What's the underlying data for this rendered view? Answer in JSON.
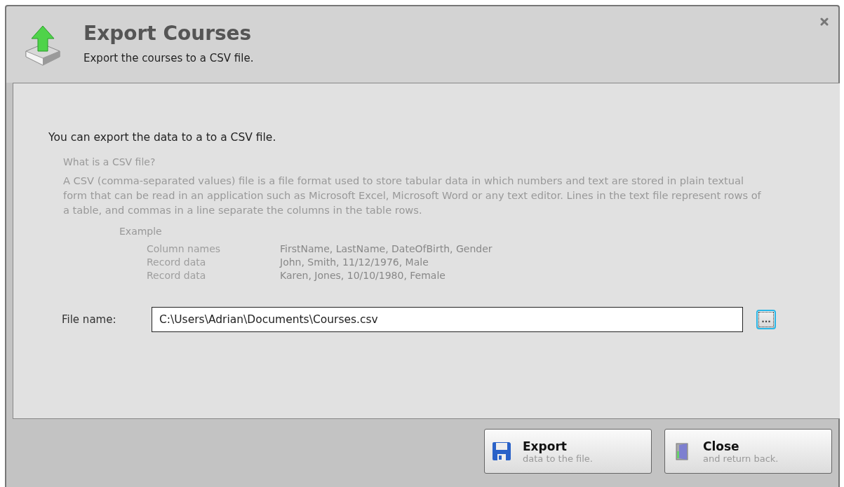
{
  "dialog": {
    "title": "Export Courses",
    "subtitle": "Export the courses to a CSV file."
  },
  "intro": "You can export the data to a to a CSV file.",
  "help": {
    "heading": "What is a CSV file?",
    "body": "A CSV (comma-separated values) file is a file format used to store tabular data in which numbers and text are stored in plain textual form that can be read in an application such as Microsoft Excel, Microsoft Word or any text editor. Lines in the text file represent rows of a table, and commas in a line separate the columns in the table rows.",
    "example_heading": "Example",
    "example_rows": [
      {
        "label": "Column names",
        "value": "FirstName, LastName, DateOfBirth, Gender"
      },
      {
        "label": "Record data",
        "value": "John, Smith, 11/12/1976, Male"
      },
      {
        "label": "Record data",
        "value": "Karen, Jones, 10/10/1980, Female"
      }
    ]
  },
  "file_name": {
    "label": "File name:",
    "value": "C:\\Users\\Adrian\\Documents\\Courses.csv",
    "browse_label": "...",
    "browse_focused": true
  },
  "buttons": [
    {
      "kind": "export",
      "label": "Export",
      "hint": "data to the file."
    },
    {
      "kind": "close",
      "label": "Close",
      "hint": "and return back."
    }
  ]
}
